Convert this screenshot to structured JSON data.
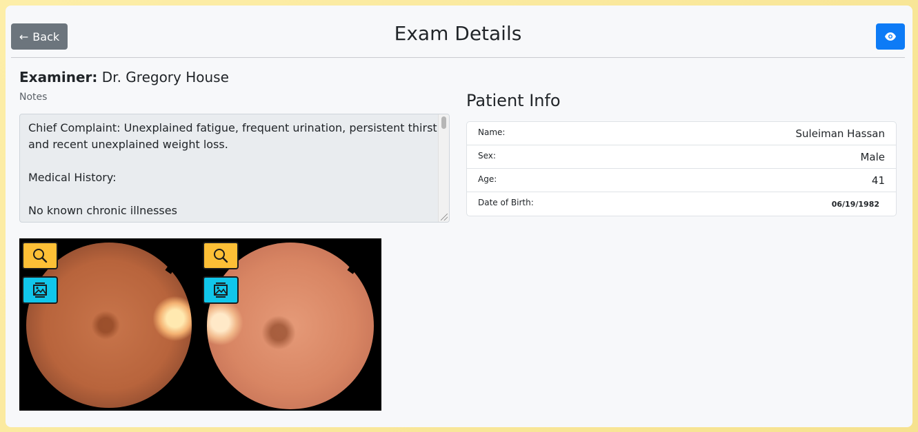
{
  "header": {
    "back_label": "Back",
    "back_arrow": "←",
    "title": "Exam Details",
    "view_icon": "eye-icon"
  },
  "examiner": {
    "label": "Examiner:",
    "name": "Dr. Gregory House"
  },
  "notes": {
    "label": "Notes",
    "text": "Chief Complaint: Unexplained fatigue, frequent urination, persistent thirst, and recent unexplained weight loss.\n\nMedical History:\n\nNo known chronic illnesses"
  },
  "images": [
    {
      "eye": "right",
      "tools": [
        "search-icon",
        "image-gallery-icon"
      ]
    },
    {
      "eye": "left",
      "tools": [
        "search-icon",
        "image-gallery-icon"
      ]
    }
  ],
  "patient": {
    "title": "Patient Info",
    "rows": [
      {
        "label": "Name:",
        "value": "Suleiman Hassan"
      },
      {
        "label": "Sex:",
        "value": "Male"
      },
      {
        "label": "Age:",
        "value": "41"
      },
      {
        "label": "Date of Birth:",
        "value": "06/19/1982"
      }
    ]
  },
  "colors": {
    "primary": "#0d7bf6",
    "secondary": "#6c757d",
    "zoom_button": "#fdbf36",
    "gallery_button": "#11c6ea"
  }
}
